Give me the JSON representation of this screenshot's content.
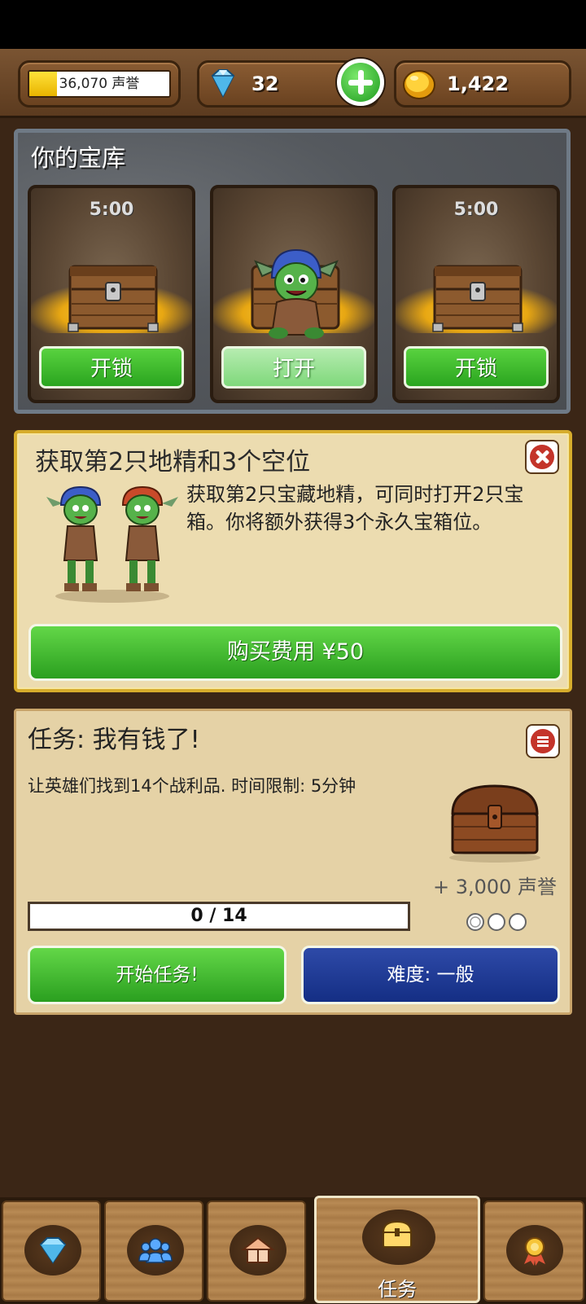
{
  "topbar": {
    "reputation": {
      "text": "36,070 声誉",
      "fill_fraction": 0.2
    },
    "gems": "32",
    "gold": "1,422"
  },
  "vault": {
    "title": "你的宝库",
    "slots": [
      {
        "timer": "5:00",
        "button": "开锁",
        "content": "chest"
      },
      {
        "timer": "",
        "button": "打开",
        "content": "goblin"
      },
      {
        "timer": "5:00",
        "button": "开锁",
        "content": "chest"
      }
    ]
  },
  "offer": {
    "title": "获取第2只地精和3个空位",
    "description": "获取第2只宝藏地精，可同时打开2只宝箱。你将额外获得3个永久宝箱位。",
    "buy_label": "购买费用 ¥50"
  },
  "task": {
    "title": "任务: 我有钱了!",
    "description": "让英雄们找到14个战利品. 时间限制: 5分钟",
    "reward": "+ 3,000 声誉",
    "progress": "0 / 14",
    "difficulty_stars_filled": 0,
    "start_label": "开始任务!",
    "difficulty_label": "难度: 一般"
  },
  "bottom_nav": {
    "tabs": [
      {
        "icon": "diamond-icon"
      },
      {
        "icon": "heroes-icon"
      },
      {
        "icon": "buildings-icon"
      },
      {
        "icon": "treasure-chest-icon",
        "label": "任务",
        "active": true
      },
      {
        "icon": "achievement-medal-icon"
      }
    ]
  },
  "colors": {
    "green_button": "#3cbc2c",
    "blue_button": "#1e3a94",
    "panel_tan": "#ecdcb0",
    "background": "#3b2616"
  }
}
